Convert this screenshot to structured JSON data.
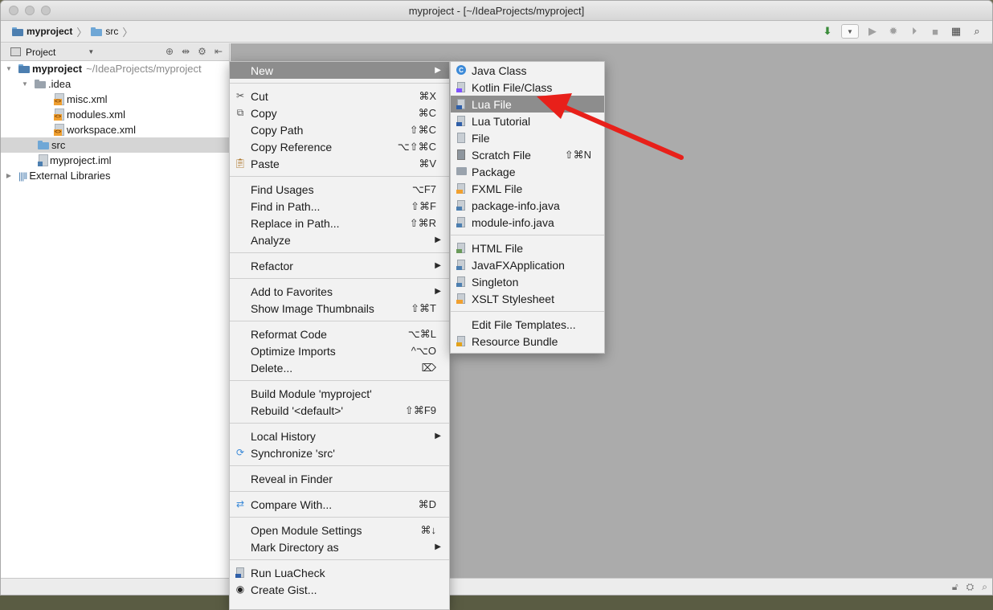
{
  "window": {
    "title": "myproject - [~/IdeaProjects/myproject]"
  },
  "navbar": {
    "breadcrumbs": [
      "myproject",
      "src"
    ]
  },
  "project_panel": {
    "header_label": "Project",
    "tree": {
      "root_name": "myproject",
      "root_path": "~/IdeaProjects/myproject",
      "idea_folder": ".idea",
      "idea_files": [
        "misc.xml",
        "modules.xml",
        "workspace.xml"
      ],
      "src_folder": "src",
      "iml_file": "myproject.iml",
      "external_libraries": "External Libraries"
    }
  },
  "context_menu": {
    "items": [
      {
        "label": "New",
        "shortcut": "▶"
      },
      {
        "label": "Cut",
        "shortcut": "⌘X"
      },
      {
        "label": "Copy",
        "shortcut": "⌘C"
      },
      {
        "label": "Copy Path",
        "shortcut": "⇧⌘C"
      },
      {
        "label": "Copy Reference",
        "shortcut": "⌥⇧⌘C"
      },
      {
        "label": "Paste",
        "shortcut": "⌘V"
      },
      {
        "label": "Find Usages",
        "shortcut": "⌥F7"
      },
      {
        "label": "Find in Path...",
        "shortcut": "⇧⌘F"
      },
      {
        "label": "Replace in Path...",
        "shortcut": "⇧⌘R"
      },
      {
        "label": "Analyze",
        "shortcut": "▶"
      },
      {
        "label": "Refactor",
        "shortcut": "▶"
      },
      {
        "label": "Add to Favorites",
        "shortcut": "▶"
      },
      {
        "label": "Show Image Thumbnails",
        "shortcut": "⇧⌘T"
      },
      {
        "label": "Reformat Code",
        "shortcut": "⌥⌘L"
      },
      {
        "label": "Optimize Imports",
        "shortcut": "^⌥O"
      },
      {
        "label": "Delete...",
        "shortcut": "⌦"
      },
      {
        "label": "Build Module 'myproject'",
        "shortcut": ""
      },
      {
        "label": "Rebuild '<default>'",
        "shortcut": "⇧⌘F9"
      },
      {
        "label": "Local History",
        "shortcut": "▶"
      },
      {
        "label": "Synchronize 'src'",
        "shortcut": ""
      },
      {
        "label": "Reveal in Finder",
        "shortcut": ""
      },
      {
        "label": "Compare With...",
        "shortcut": "⌘D"
      },
      {
        "label": "Open Module Settings",
        "shortcut": "⌘↓"
      },
      {
        "label": "Mark Directory as",
        "shortcut": "▶"
      },
      {
        "label": "Run LuaCheck",
        "shortcut": ""
      },
      {
        "label": "Create Gist...",
        "shortcut": ""
      }
    ]
  },
  "new_submenu": {
    "items": [
      {
        "label": "Java Class",
        "shortcut": ""
      },
      {
        "label": "Kotlin File/Class",
        "shortcut": ""
      },
      {
        "label": "Lua File",
        "shortcut": ""
      },
      {
        "label": "Lua Tutorial",
        "shortcut": ""
      },
      {
        "label": "File",
        "shortcut": ""
      },
      {
        "label": "Scratch File",
        "shortcut": "⇧⌘N"
      },
      {
        "label": "Package",
        "shortcut": ""
      },
      {
        "label": "FXML File",
        "shortcut": ""
      },
      {
        "label": "package-info.java",
        "shortcut": ""
      },
      {
        "label": "module-info.java",
        "shortcut": ""
      },
      {
        "label": "HTML File",
        "shortcut": ""
      },
      {
        "label": "JavaFXApplication",
        "shortcut": ""
      },
      {
        "label": "Singleton",
        "shortcut": ""
      },
      {
        "label": "XSLT Stylesheet",
        "shortcut": ""
      },
      {
        "label": "Edit File Templates...",
        "shortcut": ""
      },
      {
        "label": "Resource Bundle",
        "shortcut": ""
      }
    ]
  },
  "colors": {
    "highlight": "#8d8d8d",
    "annotation_arrow": "#e8201a",
    "folder": "#6fa7d6"
  }
}
